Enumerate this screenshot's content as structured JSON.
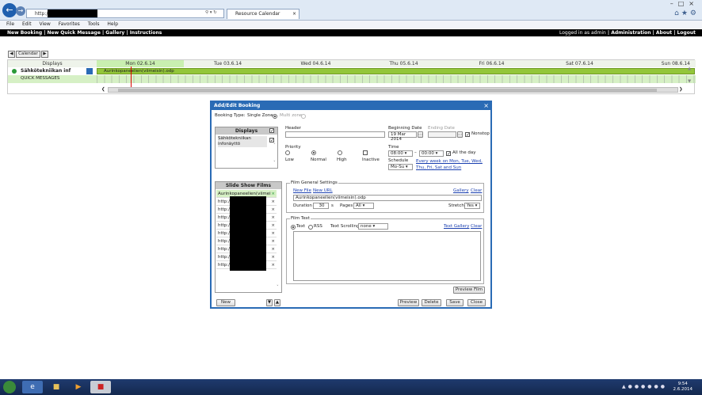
{
  "browser": {
    "url": "http://",
    "tab_title": "Resource Calendar",
    "menu": [
      "File",
      "Edit",
      "View",
      "Favorites",
      "Tools",
      "Help"
    ]
  },
  "appnav": {
    "left": [
      "New Booking",
      "New Quick Message",
      "Gallery",
      "Instructions"
    ],
    "right": [
      "Logged in as admin",
      "Administration",
      "About",
      "Logout"
    ]
  },
  "calendar": {
    "button_label": "Calendar",
    "displays_label": "Displays",
    "days": [
      "Mon 02.6.14",
      "Tue 03.6.14",
      "Wed 04.6.14",
      "Thu 05.6.14",
      "Fri 06.6.14",
      "Sat 07.6.14",
      "Sun 08.6.14"
    ],
    "resource_name": "Sähkötekniikan inf",
    "booking_label": "Aurinkopaneelien(viimeisin).odp",
    "quick_messages_label": "QUICK MESSAGES"
  },
  "dialog": {
    "title": "Add/Edit Booking",
    "booking_type_label": "Booking Type:",
    "single_zone": "Single Zone",
    "multi_zone": "Multi zone",
    "displays_header": "Displays",
    "display_item": "Sähkötekniikan infonäyttö",
    "header_label": "Header",
    "beginning_date_label": "Beginning Date",
    "beginning_date_value": "19 Mar 2014",
    "ending_date_label": "Ending Date",
    "nonstop_label": "Nonstop",
    "priority_label": "Priority",
    "priorities": [
      "Low",
      "Normal",
      "High",
      "Inactive"
    ],
    "time_label": "Time",
    "time_start": "08:00",
    "time_end": "00:00",
    "all_the_day_label": "All the day",
    "schedule_label": "Schedule",
    "schedule_value": "Mo-Su",
    "schedule_link": "Every week on Mon, Tue, Wed, Thu, Fri, Sat and Sun",
    "films_header": "Slide Show Films",
    "films": [
      "Aurinkopaneelien(viimei",
      "http:/",
      "http:/",
      "http:/",
      "http:/",
      "http:/",
      "http:/",
      "http:/",
      "http:/",
      "http:/"
    ],
    "film_settings_legend": "Film General Settings",
    "new_file_link": "New File",
    "new_url_link": "New URL",
    "gallery_link": "Gallery",
    "clear_link": "Clear",
    "film_name_value": "Aurinkopaneelien(viimeisin).odp",
    "duration_label": "Duration",
    "duration_value": "30",
    "duration_unit": "s",
    "pages_label": "Pages",
    "pages_value": "All",
    "stretch_label": "Stretch",
    "stretch_value": "Yes",
    "film_text_legend": "Film Text",
    "text_option": "Text",
    "rss_option": "RSS",
    "text_scrolling_label": "Text Scrolling",
    "text_scrolling_value": "none",
    "text_gallery_link": "Text Gallery",
    "text_clear_link": "Clear",
    "preview_film_button": "Preview Film",
    "new_button": "New",
    "preview_button": "Preview",
    "delete_button": "Delete",
    "save_button": "Save",
    "close_button": "Close"
  },
  "taskbar": {
    "time": "9:54",
    "date": "2.6.2014"
  },
  "colors": {
    "app_accent": "#2a6bb5",
    "booking_green": "#93c63a",
    "quick_messages_bg": "#d6f0c5"
  }
}
